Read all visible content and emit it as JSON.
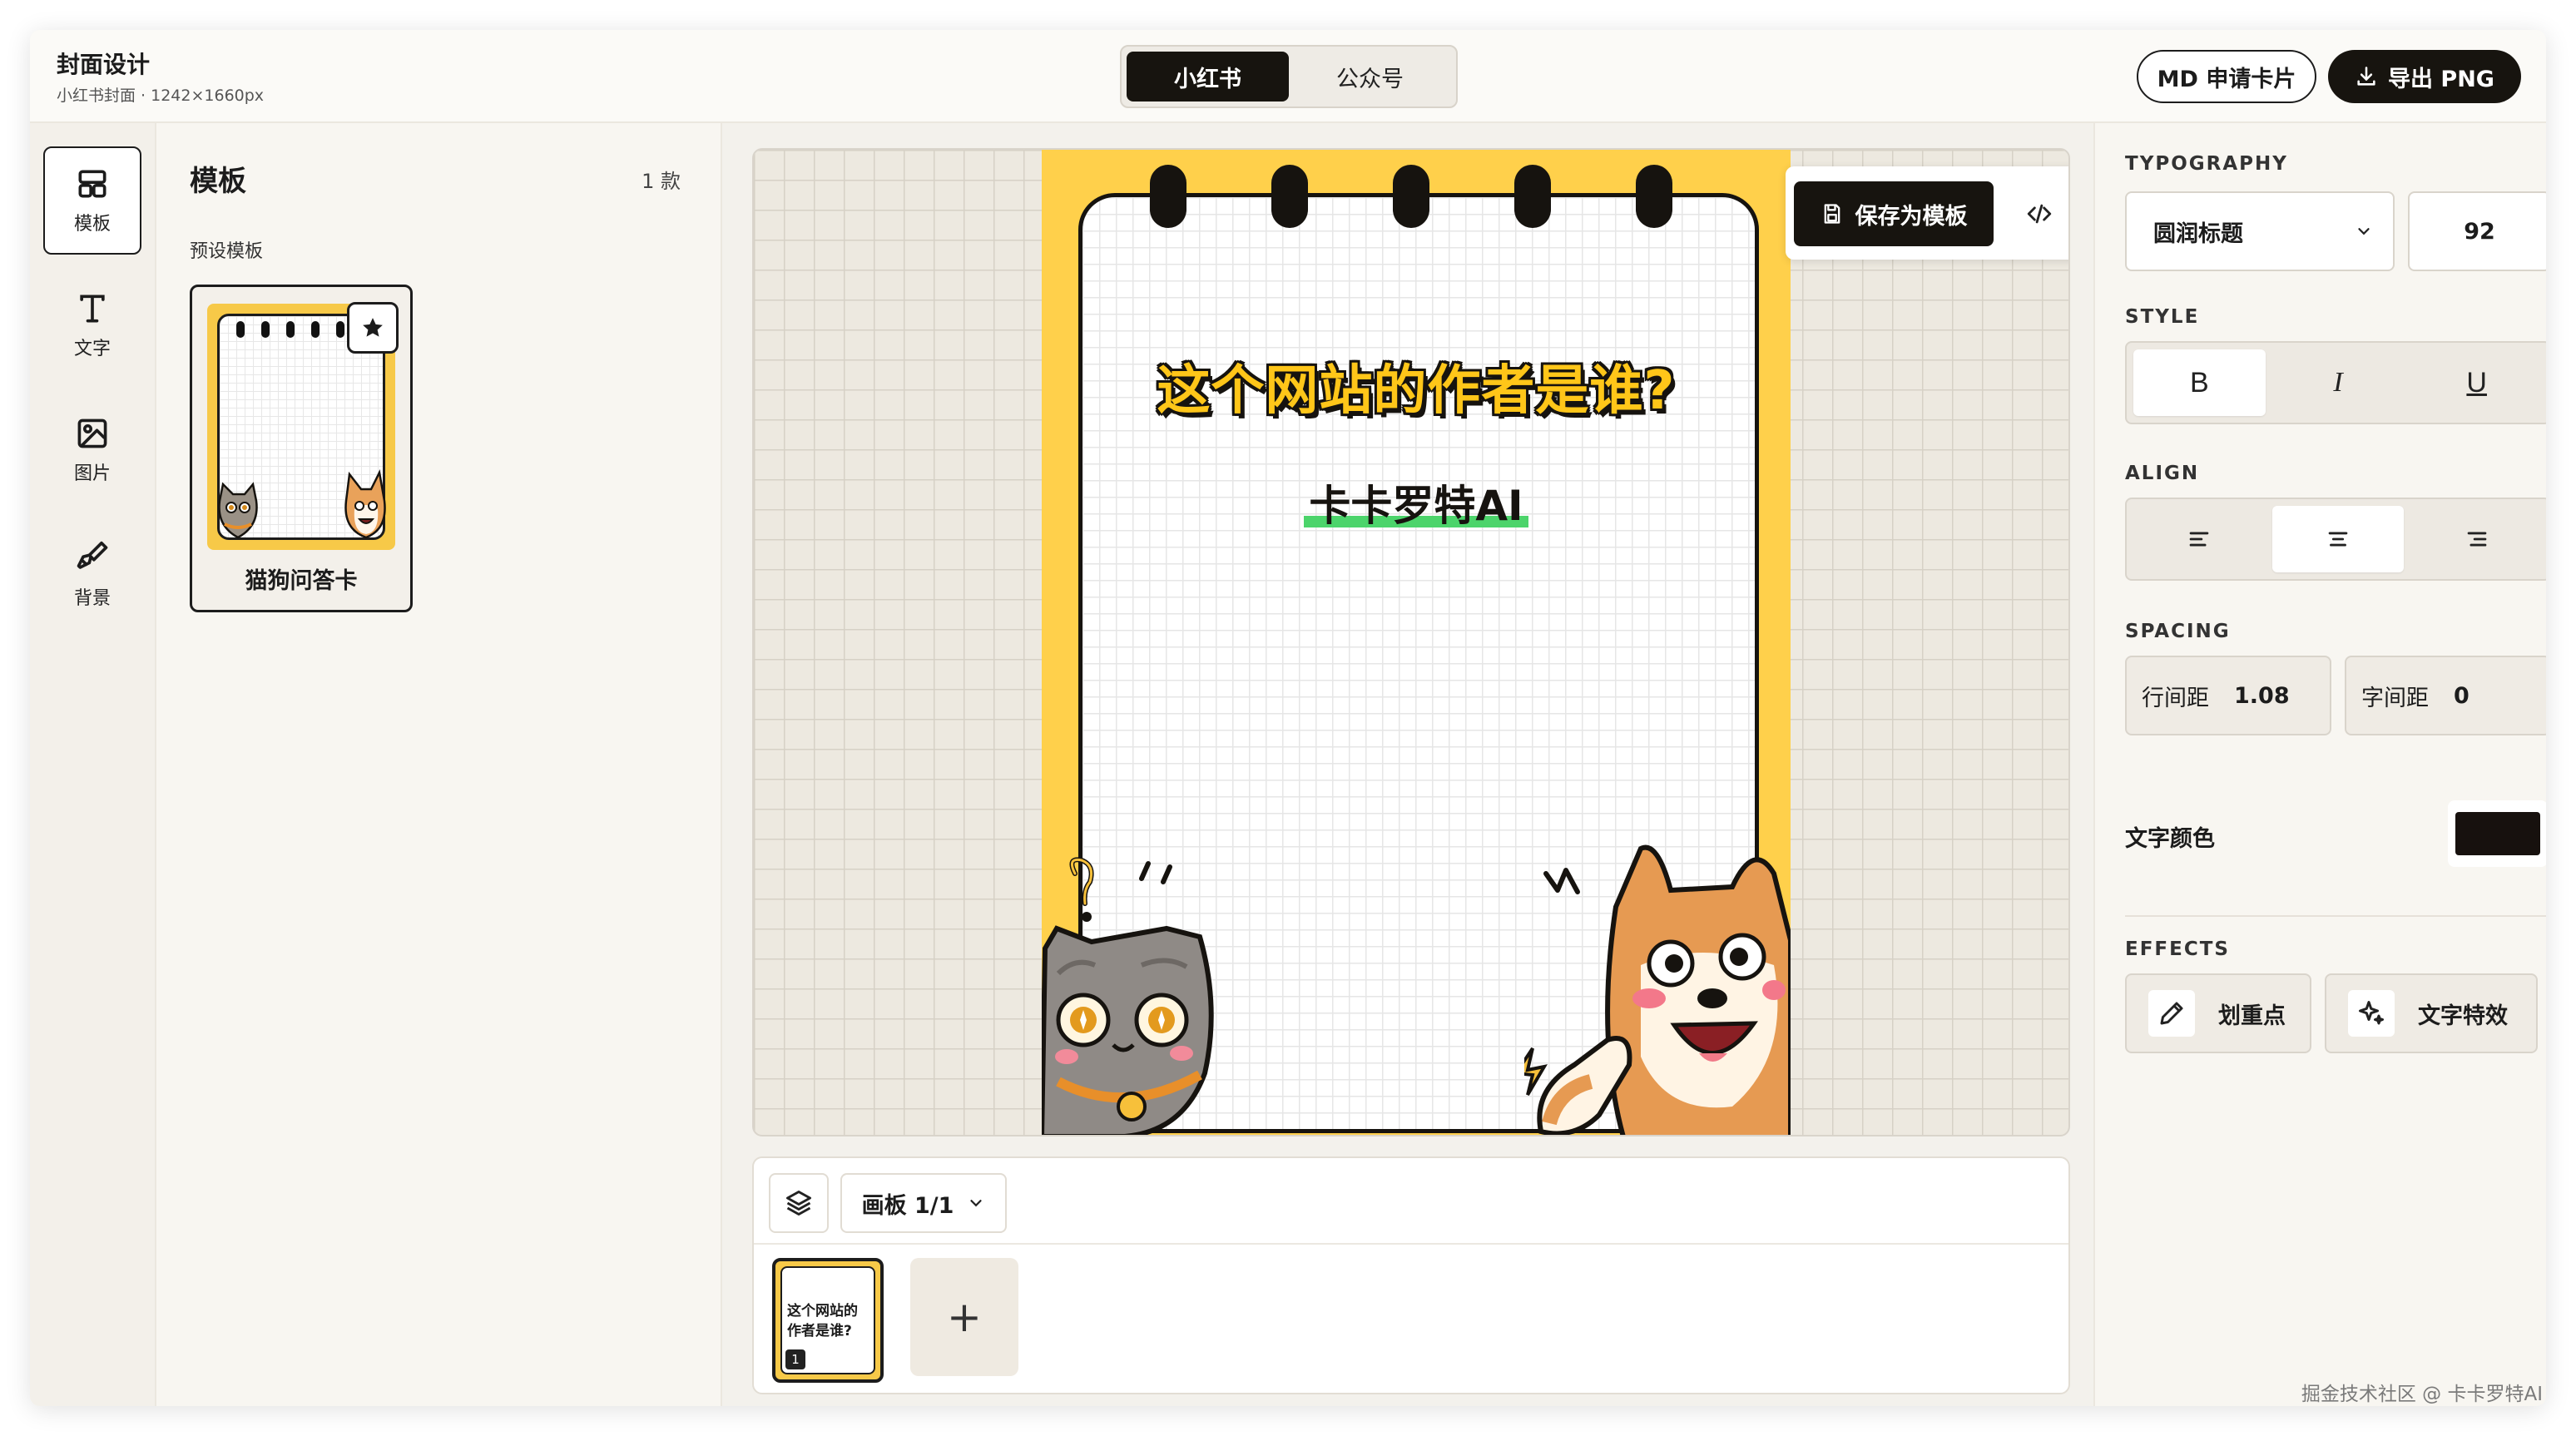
{
  "header": {
    "title": "封面设计",
    "subtitle": "小红书封面 · 1242×1660px",
    "platform_tabs": [
      "小红书",
      "公众号"
    ],
    "md_button": "MD 申请卡片",
    "export_button": "导出 PNG"
  },
  "rail": {
    "items": [
      {
        "label": "模板",
        "icon": "layout-icon"
      },
      {
        "label": "文字",
        "icon": "text-icon"
      },
      {
        "label": "图片",
        "icon": "image-icon"
      },
      {
        "label": "背景",
        "icon": "brush-icon"
      }
    ]
  },
  "templates": {
    "title": "模板",
    "count": "1 款",
    "section": "预设模板",
    "items": [
      {
        "name": "猫狗问答卡"
      }
    ]
  },
  "canvas": {
    "headline": "这个网站的作者是谁?",
    "subline": "卡卡罗特AI",
    "save_template": "保存为模板",
    "colors": {
      "cover_bg": "#ffd04b",
      "headline": "#ffc619",
      "highlight": "#4cd46b"
    }
  },
  "boards": {
    "selector": "画板 1/1",
    "thumb_text": "这个网站的作者是谁?",
    "thumb_number": "1",
    "add": "+"
  },
  "props": {
    "typography_label": "TYPOGRAPHY",
    "font": "圆润标题",
    "font_size": "92",
    "style_label": "STYLE",
    "style_buttons": [
      "B",
      "I",
      "U"
    ],
    "align_label": "ALIGN",
    "spacing_label": "SPACING",
    "line_height_label": "行间距",
    "line_height": "1.08",
    "letter_spacing_label": "字间距",
    "letter_spacing": "0",
    "text_color_label": "文字颜色",
    "text_color": "#17110e",
    "effects_label": "EFFECTS",
    "effects": [
      "划重点",
      "文字特效"
    ]
  },
  "watermark": "掘金技术社区 @ 卡卡罗特AI"
}
